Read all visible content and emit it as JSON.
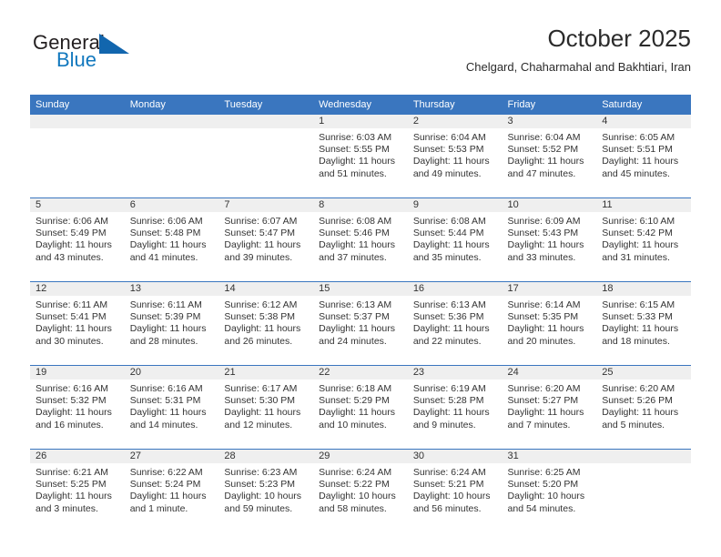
{
  "brand": {
    "name_part1": "General",
    "name_part2": "Blue",
    "triangle_icon": "triangle-icon",
    "colors": {
      "dark": "#231f20",
      "blue": "#1278be",
      "triangle": "#1266ae"
    }
  },
  "header": {
    "title": "October 2025",
    "subtitle": "Chelgard, Chaharmahal and Bakhtiari, Iran"
  },
  "calendar": {
    "accent_color": "#3a76bf",
    "daynum_band_color": "#efefef",
    "weekday_headers": [
      "Sunday",
      "Monday",
      "Tuesday",
      "Wednesday",
      "Thursday",
      "Friday",
      "Saturday"
    ],
    "weeks": [
      [
        {
          "day": "",
          "lines": []
        },
        {
          "day": "",
          "lines": []
        },
        {
          "day": "",
          "lines": []
        },
        {
          "day": "1",
          "lines": [
            "Sunrise: 6:03 AM",
            "Sunset: 5:55 PM",
            "Daylight: 11 hours",
            "and 51 minutes."
          ]
        },
        {
          "day": "2",
          "lines": [
            "Sunrise: 6:04 AM",
            "Sunset: 5:53 PM",
            "Daylight: 11 hours",
            "and 49 minutes."
          ]
        },
        {
          "day": "3",
          "lines": [
            "Sunrise: 6:04 AM",
            "Sunset: 5:52 PM",
            "Daylight: 11 hours",
            "and 47 minutes."
          ]
        },
        {
          "day": "4",
          "lines": [
            "Sunrise: 6:05 AM",
            "Sunset: 5:51 PM",
            "Daylight: 11 hours",
            "and 45 minutes."
          ]
        }
      ],
      [
        {
          "day": "5",
          "lines": [
            "Sunrise: 6:06 AM",
            "Sunset: 5:49 PM",
            "Daylight: 11 hours",
            "and 43 minutes."
          ]
        },
        {
          "day": "6",
          "lines": [
            "Sunrise: 6:06 AM",
            "Sunset: 5:48 PM",
            "Daylight: 11 hours",
            "and 41 minutes."
          ]
        },
        {
          "day": "7",
          "lines": [
            "Sunrise: 6:07 AM",
            "Sunset: 5:47 PM",
            "Daylight: 11 hours",
            "and 39 minutes."
          ]
        },
        {
          "day": "8",
          "lines": [
            "Sunrise: 6:08 AM",
            "Sunset: 5:46 PM",
            "Daylight: 11 hours",
            "and 37 minutes."
          ]
        },
        {
          "day": "9",
          "lines": [
            "Sunrise: 6:08 AM",
            "Sunset: 5:44 PM",
            "Daylight: 11 hours",
            "and 35 minutes."
          ]
        },
        {
          "day": "10",
          "lines": [
            "Sunrise: 6:09 AM",
            "Sunset: 5:43 PM",
            "Daylight: 11 hours",
            "and 33 minutes."
          ]
        },
        {
          "day": "11",
          "lines": [
            "Sunrise: 6:10 AM",
            "Sunset: 5:42 PM",
            "Daylight: 11 hours",
            "and 31 minutes."
          ]
        }
      ],
      [
        {
          "day": "12",
          "lines": [
            "Sunrise: 6:11 AM",
            "Sunset: 5:41 PM",
            "Daylight: 11 hours",
            "and 30 minutes."
          ]
        },
        {
          "day": "13",
          "lines": [
            "Sunrise: 6:11 AM",
            "Sunset: 5:39 PM",
            "Daylight: 11 hours",
            "and 28 minutes."
          ]
        },
        {
          "day": "14",
          "lines": [
            "Sunrise: 6:12 AM",
            "Sunset: 5:38 PM",
            "Daylight: 11 hours",
            "and 26 minutes."
          ]
        },
        {
          "day": "15",
          "lines": [
            "Sunrise: 6:13 AM",
            "Sunset: 5:37 PM",
            "Daylight: 11 hours",
            "and 24 minutes."
          ]
        },
        {
          "day": "16",
          "lines": [
            "Sunrise: 6:13 AM",
            "Sunset: 5:36 PM",
            "Daylight: 11 hours",
            "and 22 minutes."
          ]
        },
        {
          "day": "17",
          "lines": [
            "Sunrise: 6:14 AM",
            "Sunset: 5:35 PM",
            "Daylight: 11 hours",
            "and 20 minutes."
          ]
        },
        {
          "day": "18",
          "lines": [
            "Sunrise: 6:15 AM",
            "Sunset: 5:33 PM",
            "Daylight: 11 hours",
            "and 18 minutes."
          ]
        }
      ],
      [
        {
          "day": "19",
          "lines": [
            "Sunrise: 6:16 AM",
            "Sunset: 5:32 PM",
            "Daylight: 11 hours",
            "and 16 minutes."
          ]
        },
        {
          "day": "20",
          "lines": [
            "Sunrise: 6:16 AM",
            "Sunset: 5:31 PM",
            "Daylight: 11 hours",
            "and 14 minutes."
          ]
        },
        {
          "day": "21",
          "lines": [
            "Sunrise: 6:17 AM",
            "Sunset: 5:30 PM",
            "Daylight: 11 hours",
            "and 12 minutes."
          ]
        },
        {
          "day": "22",
          "lines": [
            "Sunrise: 6:18 AM",
            "Sunset: 5:29 PM",
            "Daylight: 11 hours",
            "and 10 minutes."
          ]
        },
        {
          "day": "23",
          "lines": [
            "Sunrise: 6:19 AM",
            "Sunset: 5:28 PM",
            "Daylight: 11 hours",
            "and 9 minutes."
          ]
        },
        {
          "day": "24",
          "lines": [
            "Sunrise: 6:20 AM",
            "Sunset: 5:27 PM",
            "Daylight: 11 hours",
            "and 7 minutes."
          ]
        },
        {
          "day": "25",
          "lines": [
            "Sunrise: 6:20 AM",
            "Sunset: 5:26 PM",
            "Daylight: 11 hours",
            "and 5 minutes."
          ]
        }
      ],
      [
        {
          "day": "26",
          "lines": [
            "Sunrise: 6:21 AM",
            "Sunset: 5:25 PM",
            "Daylight: 11 hours",
            "and 3 minutes."
          ]
        },
        {
          "day": "27",
          "lines": [
            "Sunrise: 6:22 AM",
            "Sunset: 5:24 PM",
            "Daylight: 11 hours",
            "and 1 minute."
          ]
        },
        {
          "day": "28",
          "lines": [
            "Sunrise: 6:23 AM",
            "Sunset: 5:23 PM",
            "Daylight: 10 hours",
            "and 59 minutes."
          ]
        },
        {
          "day": "29",
          "lines": [
            "Sunrise: 6:24 AM",
            "Sunset: 5:22 PM",
            "Daylight: 10 hours",
            "and 58 minutes."
          ]
        },
        {
          "day": "30",
          "lines": [
            "Sunrise: 6:24 AM",
            "Sunset: 5:21 PM",
            "Daylight: 10 hours",
            "and 56 minutes."
          ]
        },
        {
          "day": "31",
          "lines": [
            "Sunrise: 6:25 AM",
            "Sunset: 5:20 PM",
            "Daylight: 10 hours",
            "and 54 minutes."
          ]
        },
        {
          "day": "",
          "lines": []
        }
      ]
    ]
  }
}
